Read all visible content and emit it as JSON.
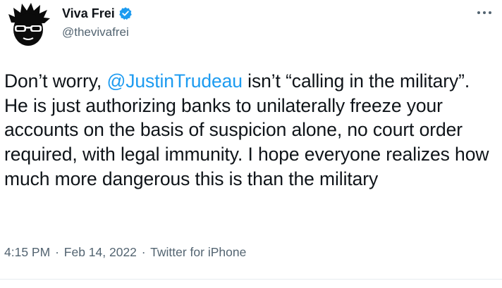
{
  "author": {
    "display_name": "Viva Frei",
    "handle": "@thevivafrei",
    "avatar_icon": "cartoon-head-with-sunglasses-icon",
    "verified_icon": "verified-badge-icon"
  },
  "menu": {
    "more_icon": "more-options-icon"
  },
  "tweet": {
    "text_before": "Don’t worry, ",
    "mention": "@JustinTrudeau",
    "text_after": " isn’t “calling in the military”. He is just authorizing banks to unilaterally freeze your accounts on the basis of suspicion alone, no court order required, with legal immunity. I hope everyone realizes how much more dangerous this is than the military"
  },
  "meta": {
    "time": "4:15 PM",
    "date": "Feb 14, 2022",
    "source": "Twitter for iPhone",
    "separator": "·"
  },
  "colors": {
    "link": "#1d9bf0",
    "secondary_text": "#536471",
    "primary_text": "#0f1419"
  }
}
